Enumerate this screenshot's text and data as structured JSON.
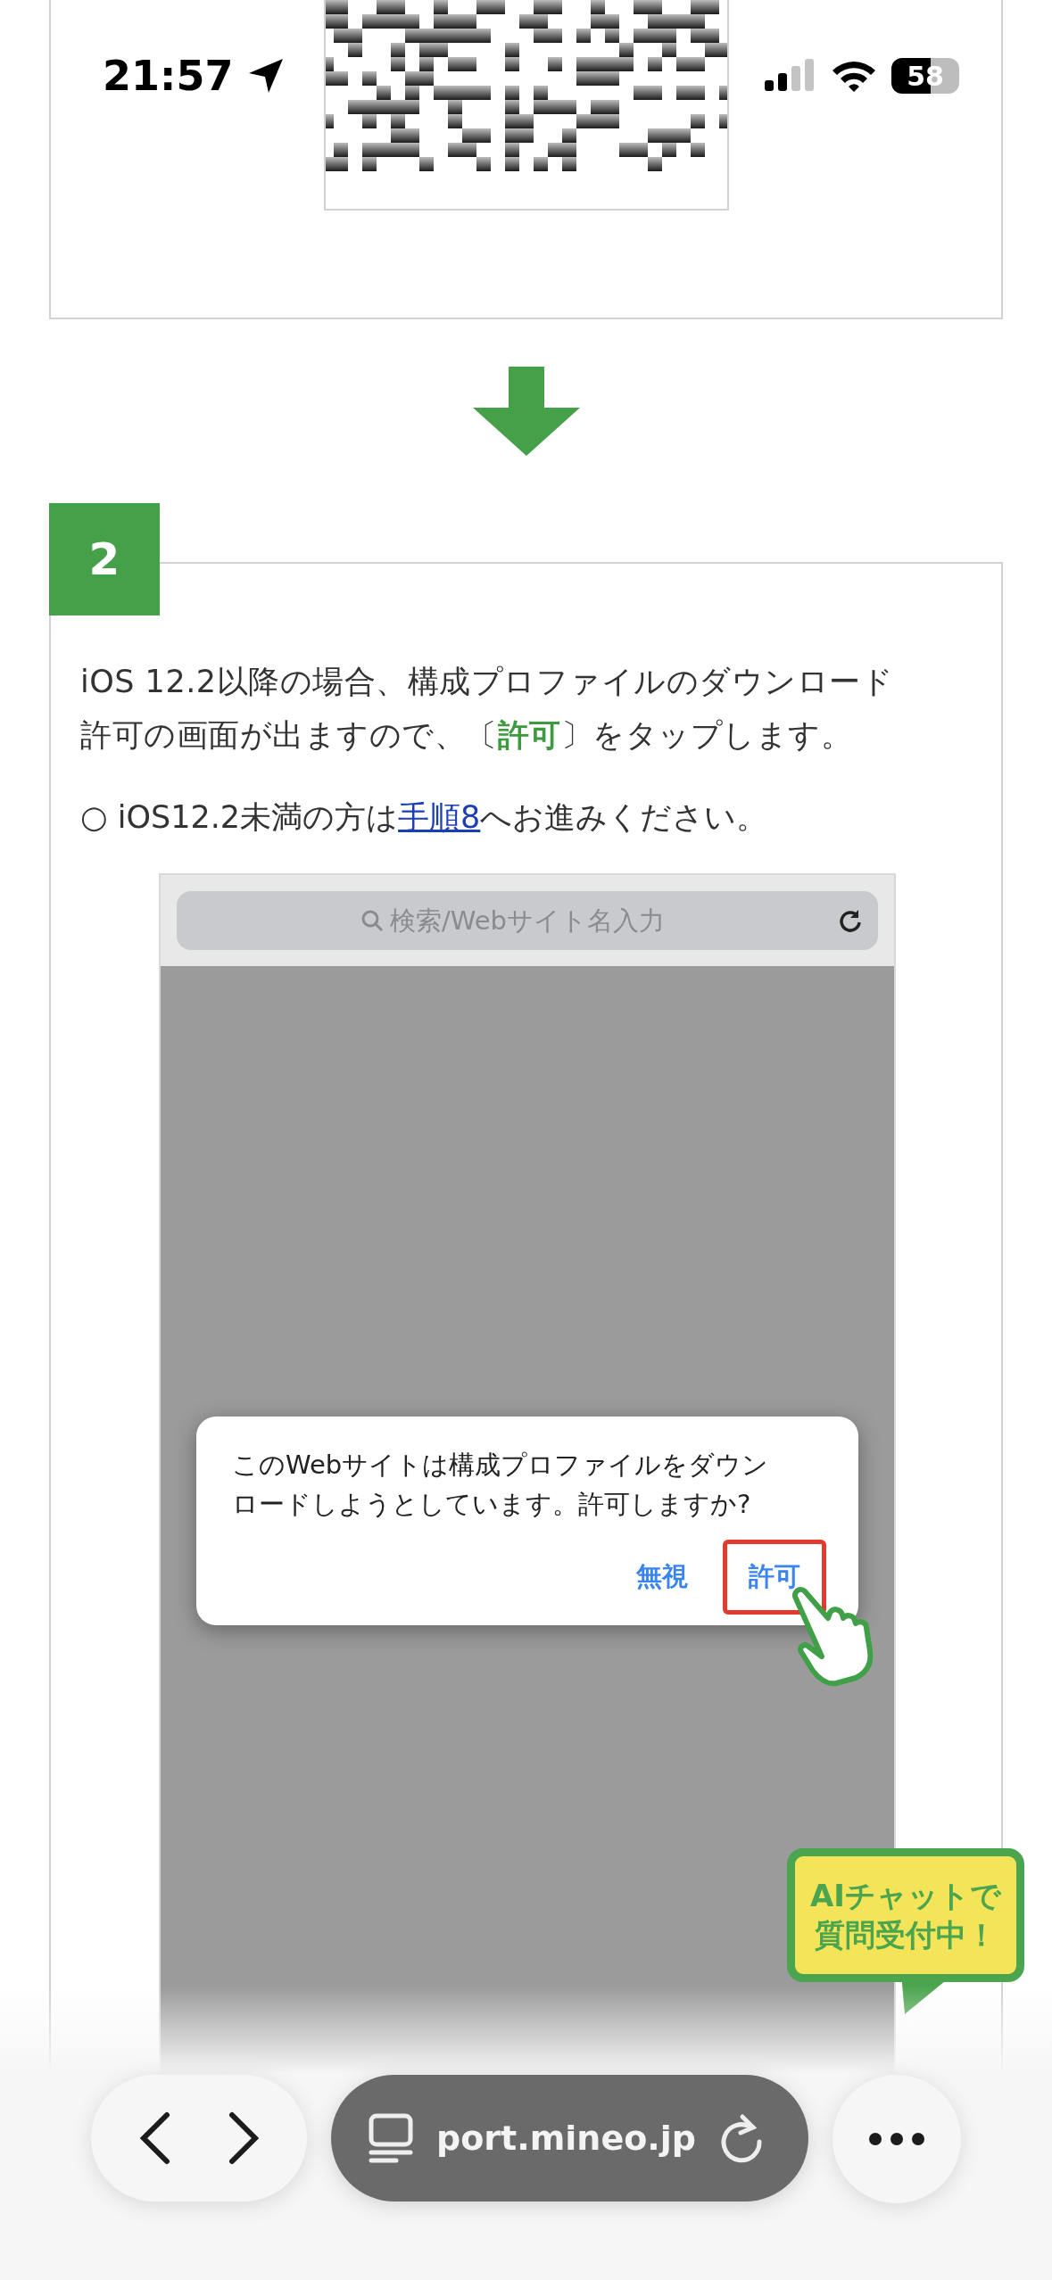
{
  "status_bar": {
    "time": "21:57",
    "battery": "58"
  },
  "step": {
    "number": "2",
    "instruction": "iOS 12.2以降の場合、構成プロファイルのダウンロード許可の画面が出ますので、〔**許可**〕をタップします。",
    "note": {
      "prefix": "○ iOS12.2未満の方は",
      "link": "手順8",
      "suffix": "へお進みください。"
    },
    "screenshot": {
      "search_placeholder": "検索/Webサイト名入力",
      "dialog": {
        "message": "このWebサイトは構成プロファイルをダウンロードしようとしています。許可しますか?",
        "buttons": [
          {
            "label": "無視",
            "highlighted": false
          },
          {
            "label": "許可",
            "highlighted": true
          }
        ]
      }
    }
  },
  "chat_bubble": {
    "lines": [
      "AIチャットで",
      "質問受付中！"
    ]
  },
  "browser_bar": {
    "url": "port.mineo.jp"
  }
}
